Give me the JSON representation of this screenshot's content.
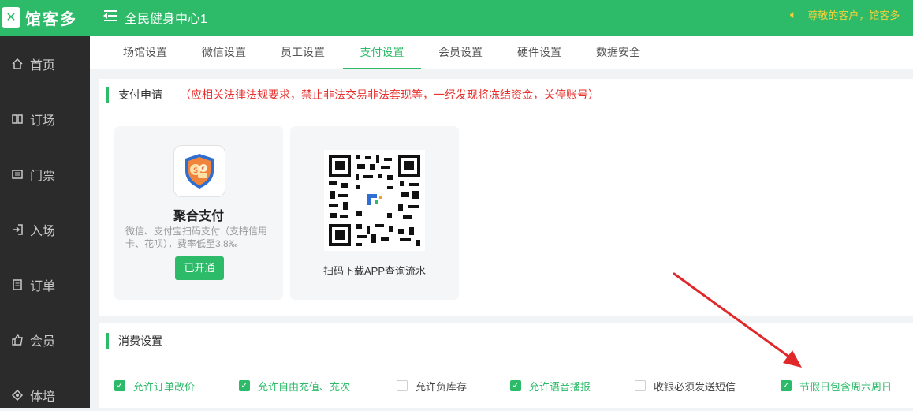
{
  "header": {
    "logo_text": "馆客多",
    "venue_name": "全民健身中心1",
    "announcement": "尊敬的客户，馆客多"
  },
  "sidebar": {
    "items": [
      {
        "label": "首页",
        "icon": "home-icon"
      },
      {
        "label": "订场",
        "icon": "booking-icon"
      },
      {
        "label": "门票",
        "icon": "ticket-icon"
      },
      {
        "label": "入场",
        "icon": "entry-icon"
      },
      {
        "label": "订单",
        "icon": "order-icon"
      },
      {
        "label": "会员",
        "icon": "member-icon"
      },
      {
        "label": "体培",
        "icon": "training-icon"
      }
    ]
  },
  "tabs": [
    {
      "label": "场馆设置"
    },
    {
      "label": "微信设置"
    },
    {
      "label": "员工设置"
    },
    {
      "label": "支付设置",
      "active": true
    },
    {
      "label": "会员设置"
    },
    {
      "label": "硬件设置"
    },
    {
      "label": "数据安全"
    }
  ],
  "payment": {
    "title": "支付申请",
    "warning": "（应相关法律法规要求，禁止非法交易非法套现等，一经发现将冻结资金，关停账号）",
    "aggregate_card": {
      "title": "聚合支付",
      "description": "微信、支付宝扫码支付（支持信用卡、花呗），费率低至3.8‰",
      "button_label": "已开通"
    },
    "app_card": {
      "caption": "扫码下载APP查询流水"
    }
  },
  "consumption": {
    "title": "消费设置",
    "options": [
      {
        "label": "允许订单改价",
        "checked": true
      },
      {
        "label": "允许自由充值、充次",
        "checked": true
      },
      {
        "label": "允许负库存",
        "checked": false
      },
      {
        "label": "允许语音播报",
        "checked": true
      },
      {
        "label": "收银必须发送短信",
        "checked": false
      },
      {
        "label": "节假日包含周六周日",
        "checked": true
      }
    ]
  },
  "colors": {
    "brand": "#2dbb6a",
    "sidebar": "#2b2b2b",
    "warning": "#e8302e",
    "annotation_arrow": "#e0282a"
  }
}
